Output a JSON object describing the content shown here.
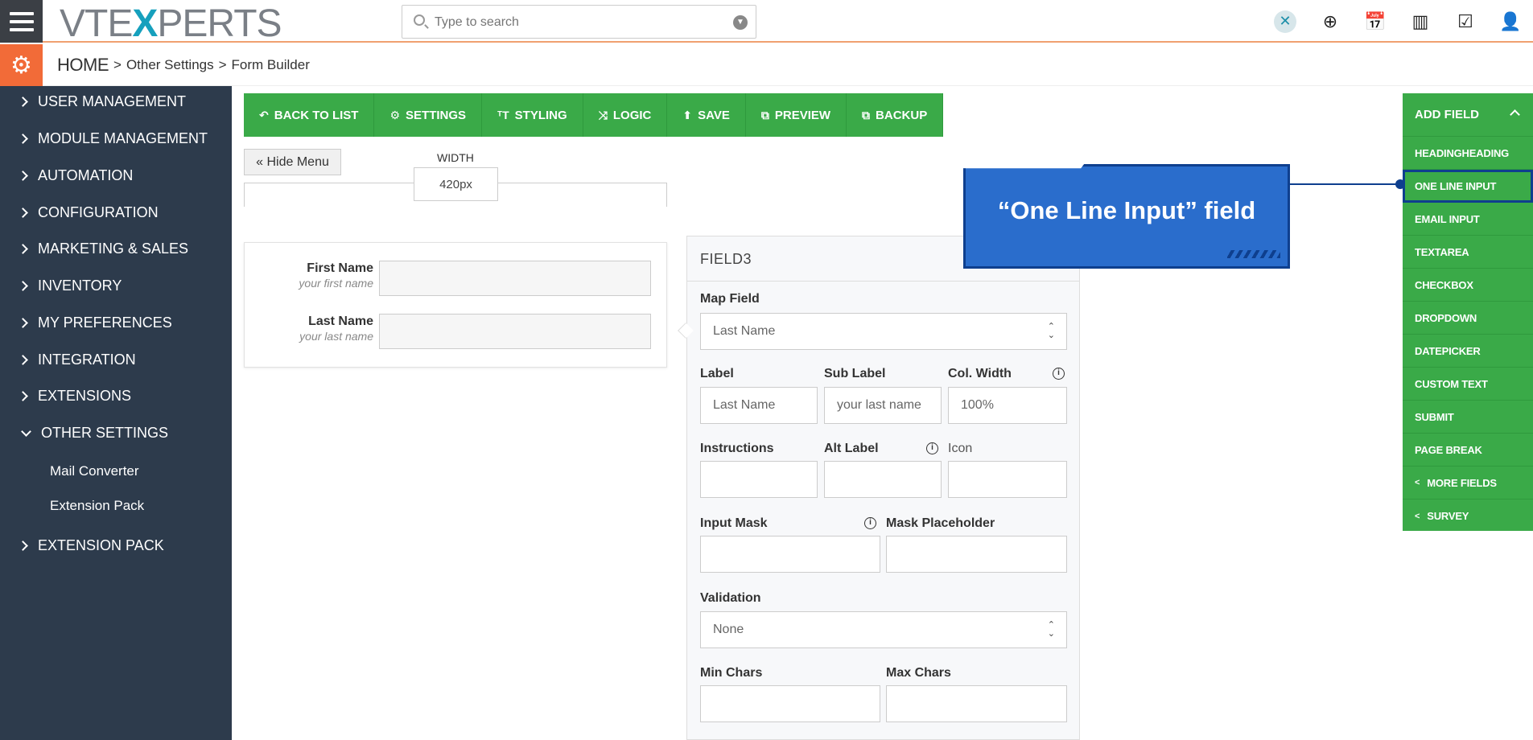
{
  "topbar": {
    "logo_prefix": "VTE",
    "logo_x": "X",
    "logo_suffix": "PERTS",
    "search_placeholder": "Type to search",
    "icons": [
      "x-badge-icon",
      "plus-circle-icon",
      "calendar-icon",
      "bar-chart-icon",
      "checkbox-icon",
      "user-icon"
    ]
  },
  "breadcrumb": {
    "home": "HOME",
    "level1": "Other Settings",
    "level2": "Form Builder",
    "separator": ">"
  },
  "sidebar": {
    "items": [
      {
        "label": "USER MANAGEMENT"
      },
      {
        "label": "MODULE MANAGEMENT"
      },
      {
        "label": "AUTOMATION"
      },
      {
        "label": "CONFIGURATION"
      },
      {
        "label": "MARKETING & SALES"
      },
      {
        "label": "INVENTORY"
      },
      {
        "label": "MY PREFERENCES"
      },
      {
        "label": "INTEGRATION"
      },
      {
        "label": "EXTENSIONS"
      },
      {
        "label": "OTHER SETTINGS"
      },
      {
        "label": "EXTENSION PACK"
      }
    ],
    "sub_items": [
      {
        "label": "Mail Converter"
      },
      {
        "label": "Extension Pack"
      }
    ]
  },
  "toolbar": {
    "back": "BACK TO LIST",
    "settings": "SETTINGS",
    "styling": "STYLING",
    "logic": "LOGIC",
    "save": "SAVE",
    "preview": "PREVIEW",
    "backup": "BACKUP"
  },
  "canvas": {
    "hide_menu": "« Hide Menu",
    "width_label": "WIDTH",
    "width_value": "420px"
  },
  "form": {
    "fields": [
      {
        "label": "First Name",
        "sublabel": "your first name"
      },
      {
        "label": "Last Name",
        "sublabel": "your last name"
      }
    ]
  },
  "editor": {
    "title": "FIELD3",
    "map_field_label": "Map Field",
    "map_field_value": "Last Name",
    "label_label": "Label",
    "label_value": "Last Name",
    "sublabel_label": "Sub Label",
    "sublabel_value": "your last name",
    "colwidth_label": "Col. Width",
    "colwidth_value": "100%",
    "instructions_label": "Instructions",
    "altlabel_label": "Alt Label",
    "icon_label": "Icon",
    "inputmask_label": "Input Mask",
    "maskplaceholder_label": "Mask Placeholder",
    "validation_label": "Validation",
    "validation_value": "None",
    "minchars_label": "Min Chars",
    "maxchars_label": "Max Chars"
  },
  "callout": {
    "text": "“One Line Input” field"
  },
  "addfield": {
    "title": "ADD FIELD",
    "items": [
      {
        "label": "HEADINGHEADING"
      },
      {
        "label": "ONE LINE INPUT"
      },
      {
        "label": "EMAIL INPUT"
      },
      {
        "label": "TEXTAREA"
      },
      {
        "label": "CHECKBOX"
      },
      {
        "label": "DROPDOWN"
      },
      {
        "label": "DATEPICKER"
      },
      {
        "label": "CUSTOM TEXT"
      },
      {
        "label": "SUBMIT"
      },
      {
        "label": "PAGE BREAK"
      },
      {
        "label": "MORE FIELDS"
      },
      {
        "label": "SURVEY"
      }
    ]
  },
  "colors": {
    "sidebar_bg": "#2d3b4c",
    "toolbar_green": "#3aaa48",
    "accent_orange": "#f26b38",
    "callout_blue": "#2a6dcc"
  }
}
